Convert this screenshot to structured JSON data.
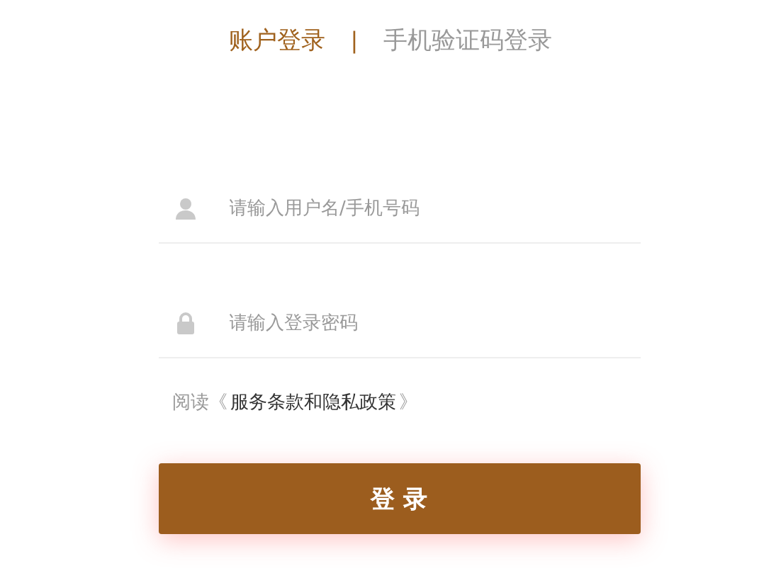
{
  "tabs": [
    {
      "label": "账户登录",
      "selected": true
    },
    {
      "label": "手机验证码登录",
      "selected": false
    }
  ],
  "tab_separator": "|",
  "fields": [
    {
      "kind": "user",
      "placeholder": "请输入用户名/手机号码"
    },
    {
      "kind": "lock",
      "placeholder": "请输入登录密码"
    }
  ],
  "agreement": {
    "prefix": "阅读《",
    "link": "服务条款和隐私政策",
    "suffix": "》"
  },
  "login_button": "登 录"
}
